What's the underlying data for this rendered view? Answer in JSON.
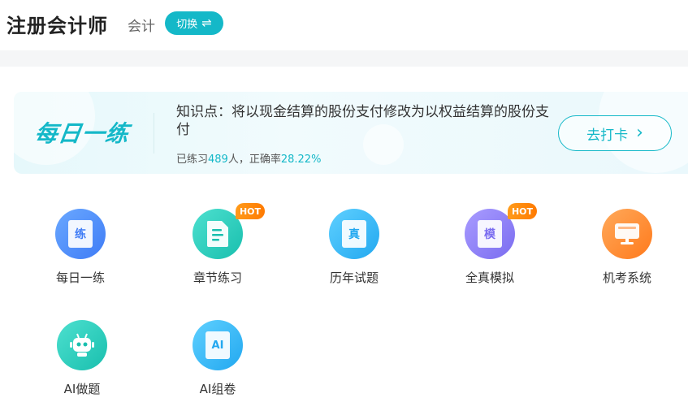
{
  "header": {
    "title": "注册会计师",
    "subject": "会计",
    "switch_label": "切换",
    "switch_icon": "⇌"
  },
  "daily": {
    "logo": "每日一练",
    "point": "知识点：将以现金结算的股份支付修改为以权益结算的股份支付",
    "stats_prefix": "已练习",
    "stats_count": "489",
    "stats_mid": "人，正确率",
    "stats_rate": "28.22%",
    "button_label": "去打卡",
    "button_icon": "›"
  },
  "colors": {
    "accent": "#14b8c8",
    "hot": "#ff8a00"
  },
  "grid": [
    {
      "label": "每日一练",
      "glyph": "练",
      "icon": "daily-practice-icon",
      "hot": ""
    },
    {
      "label": "章节练习",
      "glyph": "",
      "icon": "chapter-doc-icon",
      "hot": "HOT"
    },
    {
      "label": "历年试题",
      "glyph": "真",
      "icon": "past-exam-icon",
      "hot": ""
    },
    {
      "label": "全真模拟",
      "glyph": "模",
      "icon": "mock-exam-icon",
      "hot": "HOT"
    },
    {
      "label": "机考系统",
      "glyph": "",
      "icon": "computer-exam-icon",
      "hot": ""
    },
    {
      "label": "AI做题",
      "glyph": "",
      "icon": "ai-robot-icon",
      "hot": ""
    },
    {
      "label": "AI组卷",
      "glyph": "AI",
      "icon": "ai-paper-icon",
      "hot": ""
    }
  ]
}
